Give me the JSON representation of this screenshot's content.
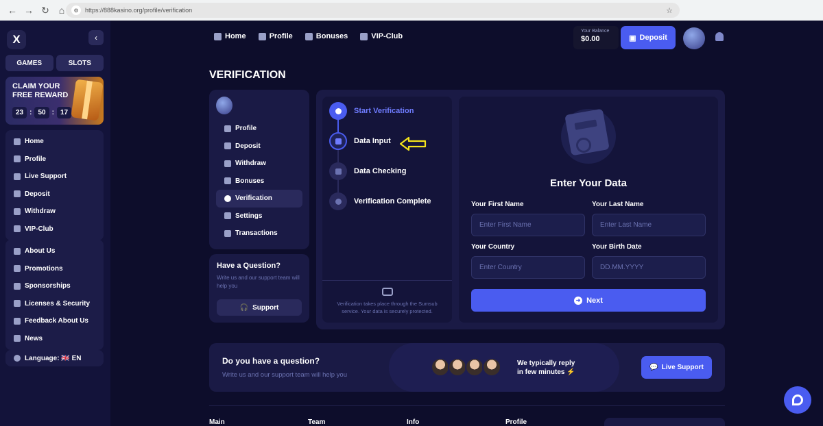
{
  "browser": {
    "url": "https://888kasino.org/profile/verification"
  },
  "sidebar": {
    "logo": "X",
    "tabs": [
      "GAMES",
      "SLOTS"
    ],
    "reward": {
      "title": "CLAIM YOUR FREE REWARD",
      "hours": "23",
      "minutes": "50",
      "seconds": "17"
    },
    "menu1": [
      "Home",
      "Profile",
      "Live Support",
      "Deposit",
      "Withdraw",
      "VIP-Club"
    ],
    "menu2": [
      "About Us",
      "Promotions",
      "Sponsorships",
      "Licenses & Security",
      "Feedback About Us",
      "News"
    ],
    "language": "Language: 🇬🇧 EN"
  },
  "header": {
    "nav": [
      "Home",
      "Profile",
      "Bonuses",
      "VIP-Club"
    ],
    "balance_label": "Your Balance",
    "balance_value": "$0.00",
    "deposit": "Deposit"
  },
  "page": {
    "title": "VERIFICATION"
  },
  "profile_menu": [
    "Profile",
    "Deposit",
    "Withdraw",
    "Bonuses",
    "Verification",
    "Settings",
    "Transactions"
  ],
  "question": {
    "title": "Have a Question?",
    "text": "Write us and our support team will help you",
    "button": "Support"
  },
  "steps": {
    "items": [
      "Start Verification",
      "Data Input",
      "Data Checking",
      "Verification Complete"
    ],
    "note": "Verification takes place through the Sumsub service. Your data is securely protected."
  },
  "form": {
    "title": "Enter Your Data",
    "first_name_label": "Your First Name",
    "first_name_placeholder": "Enter First Name",
    "last_name_label": "Your Last Name",
    "last_name_placeholder": "Enter Last Name",
    "country_label": "Your Country",
    "country_placeholder": "Enter Country",
    "birth_label": "Your Birth Date",
    "birth_placeholder": "DD.MM.YYYY",
    "next": "Next"
  },
  "support_banner": {
    "title": "Do you have a question?",
    "text": "Write us and our support team will help you",
    "reply": "We typically reply",
    "reply2": "in few minutes",
    "button": "Live Support"
  },
  "footer": [
    "Main",
    "Team",
    "Info",
    "Profile"
  ],
  "colors": {
    "accent": "#4a5cf0",
    "bg": "#0d0d2b",
    "annotation_arrow": "#f5e51b"
  }
}
